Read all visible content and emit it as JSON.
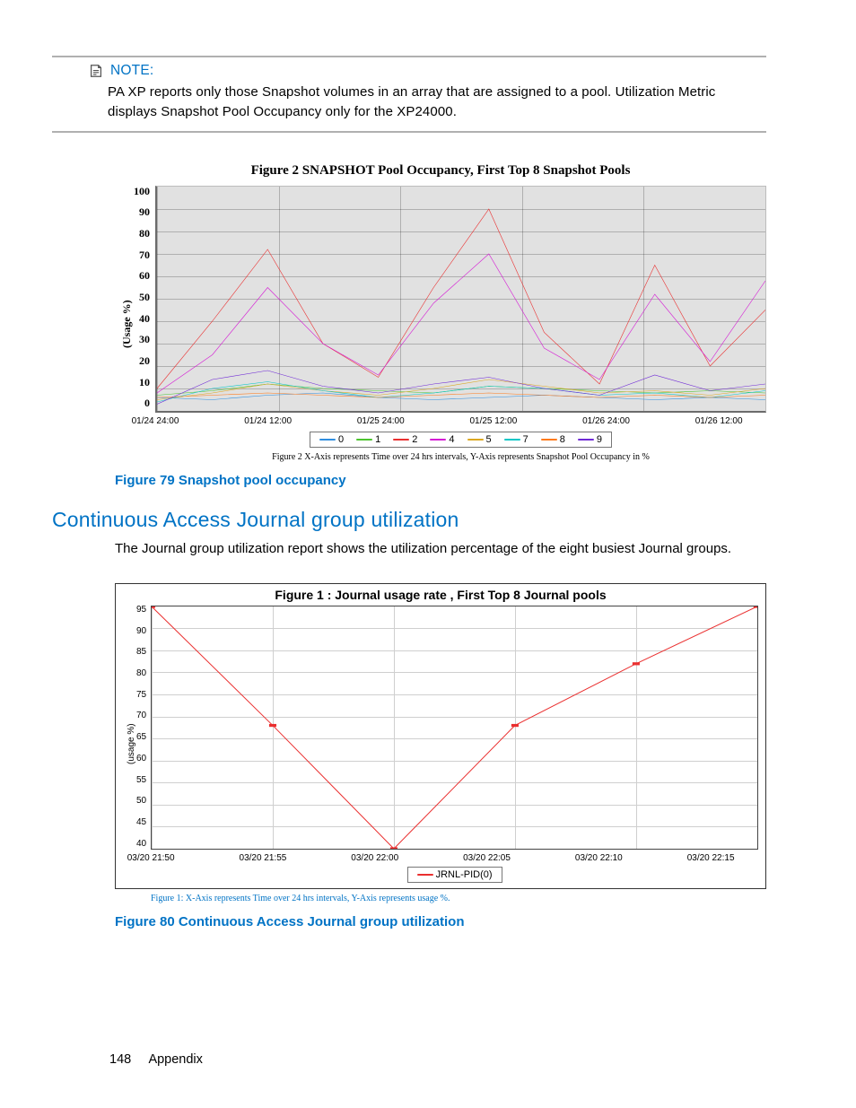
{
  "note": {
    "label": "NOTE:",
    "body": "PA XP reports only those Snapshot volumes in an array that are assigned to a pool. Utilization Metric displays Snapshot Pool Occupancy only for the XP24000."
  },
  "figure79": {
    "caption": "Figure 79 Snapshot pool occupancy"
  },
  "chart_data": [
    {
      "type": "line",
      "title": "Figure 2 SNAPSHOT Pool Occupancy, First Top 8 Snapshot Pools",
      "ylabel": "(Usage %)",
      "ylim": [
        0,
        100
      ],
      "yticks": [
        0,
        10,
        20,
        30,
        40,
        50,
        60,
        70,
        80,
        90,
        100
      ],
      "xticks": [
        "01/24 24:00",
        "01/24 12:00",
        "01/25 24:00",
        "01/25 12:00",
        "01/26 24:00",
        "01/26 12:00"
      ],
      "legend": [
        "0",
        "1",
        "2",
        "4",
        "5",
        "7",
        "8",
        "9"
      ],
      "axis_note": "Figure 2 X-Axis represents Time over 24 hrs intervals, Y-Axis represents Snapshot Pool Occupancy in %",
      "series": [
        {
          "name": "0",
          "color": "#2e8ee0",
          "values": [
            6,
            5,
            7,
            8,
            6,
            5,
            6,
            7,
            6,
            5,
            6,
            5
          ]
        },
        {
          "name": "1",
          "color": "#4cc42e",
          "values": [
            7,
            9,
            12,
            10,
            9,
            8,
            11,
            10,
            9,
            8,
            9,
            8
          ]
        },
        {
          "name": "2",
          "color": "#ea2f2f",
          "values": [
            10,
            40,
            72,
            30,
            15,
            55,
            90,
            35,
            12,
            65,
            20,
            45
          ]
        },
        {
          "name": "4",
          "color": "#d51ad5",
          "values": [
            8,
            25,
            55,
            30,
            16,
            48,
            70,
            28,
            14,
            52,
            22,
            58
          ]
        },
        {
          "name": "5",
          "color": "#dca820",
          "values": [
            5,
            8,
            12,
            9,
            7,
            10,
            14,
            11,
            8,
            9,
            7,
            10
          ]
        },
        {
          "name": "7",
          "color": "#06c7c7",
          "values": [
            4,
            10,
            13,
            9,
            6,
            8,
            11,
            10,
            7,
            8,
            6,
            9
          ]
        },
        {
          "name": "8",
          "color": "#ff7a1a",
          "values": [
            6,
            7,
            8,
            7,
            6,
            7,
            8,
            7,
            6,
            7,
            6,
            7
          ]
        },
        {
          "name": "9",
          "color": "#6f29d6",
          "values": [
            3,
            14,
            18,
            11,
            8,
            12,
            15,
            10,
            7,
            16,
            9,
            12
          ]
        }
      ]
    },
    {
      "type": "line",
      "title": "Figure 1 : Journal usage rate , First Top 8 Journal pools",
      "ylabel": "(usage %)",
      "ylim": [
        40,
        95
      ],
      "yticks": [
        40,
        45,
        50,
        55,
        60,
        65,
        70,
        75,
        80,
        85,
        90,
        95
      ],
      "xticks": [
        "03/20 21:50",
        "03/20 21:55",
        "03/20 22:00",
        "03/20 22:05",
        "03/20 22:10",
        "03/20 22:15"
      ],
      "legend": [
        "JRNL-PID(0)"
      ],
      "axis_note": "Figure 1: X-Axis represents Time over 24 hrs intervals, Y-Axis represents usage %.",
      "series": [
        {
          "name": "JRNL-PID(0)",
          "color": "#ea2f2f",
          "x": [
            "03/20 21:50",
            "03/20 21:55",
            "03/20 22:00",
            "03/20 22:05",
            "03/20 22:10",
            "03/20 22:15"
          ],
          "values": [
            95,
            68,
            40,
            68,
            82,
            95
          ]
        }
      ]
    }
  ],
  "section": {
    "heading": "Continuous Access Journal group utilization",
    "para": "The Journal group utilization report shows the utilization percentage of the eight busiest Journal groups."
  },
  "figure80": {
    "caption": "Figure 80 Continuous Access Journal group utilization"
  },
  "footer": {
    "page": "148",
    "section": "Appendix"
  }
}
